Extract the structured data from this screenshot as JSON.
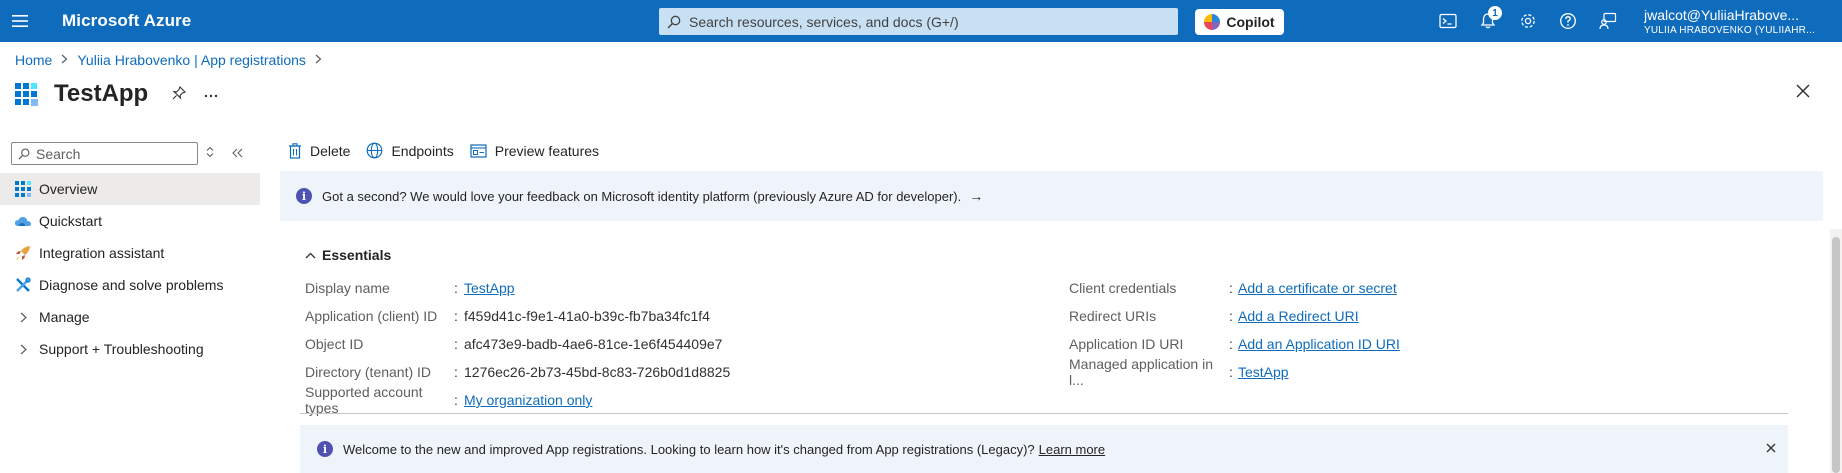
{
  "topbar": {
    "brand": "Microsoft Azure",
    "search_placeholder": "Search resources, services, and docs (G+/)",
    "copilot_label": "Copilot",
    "notification_count": "1",
    "account_email": "jwalcot@YuliiaHrabove...",
    "account_tenant": "YULIIA HRABOVENKO (YULIIAHR..."
  },
  "breadcrumb": {
    "home": "Home",
    "parent": "Yuliia Hrabovenko | App registrations"
  },
  "page": {
    "title": "TestApp"
  },
  "nav": {
    "search_placeholder": "Search",
    "items": [
      {
        "label": "Overview",
        "icon": "overview-icon"
      },
      {
        "label": "Quickstart",
        "icon": "quickstart-cloud-icon"
      },
      {
        "label": "Integration assistant",
        "icon": "rocket-icon"
      },
      {
        "label": "Diagnose and solve problems",
        "icon": "wrench-icon"
      },
      {
        "label": "Manage",
        "icon": "chevron-right-icon"
      },
      {
        "label": "Support + Troubleshooting",
        "icon": "chevron-right-icon"
      }
    ]
  },
  "commands": {
    "delete": "Delete",
    "endpoints": "Endpoints",
    "preview": "Preview features"
  },
  "feedback_banner": {
    "text": "Got a second? We would love your feedback on Microsoft identity platform (previously Azure AD for developer).",
    "arrow": "→"
  },
  "essentials": {
    "header": "Essentials",
    "left": [
      {
        "label": "Display name",
        "value": "TestApp",
        "link": true
      },
      {
        "label": "Application (client) ID",
        "value": "f459d41c-f9e1-41a0-b39c-fb7ba34fc1f4",
        "link": false
      },
      {
        "label": "Object ID",
        "value": "afc473e9-badb-4ae6-81ce-1e6f454409e7",
        "link": false
      },
      {
        "label": "Directory (tenant) ID",
        "value": "1276ec26-2b73-45bd-8c83-726b0d1d8825",
        "link": false
      },
      {
        "label": "Supported account types",
        "value": "My organization only",
        "link": true
      }
    ],
    "right": [
      {
        "label": "Client credentials",
        "value": "Add a certificate or secret",
        "link": true
      },
      {
        "label": "Redirect URIs",
        "value": "Add a Redirect URI",
        "link": true
      },
      {
        "label": "Application ID URI",
        "value": "Add an Application ID URI",
        "link": true
      },
      {
        "label": "Managed application in l...",
        "value": "TestApp",
        "link": true
      }
    ]
  },
  "welcome_banner": {
    "text": "Welcome to the new and improved App registrations. Looking to learn how it's changed from App registrations (Legacy)?",
    "link": "Learn more"
  },
  "colors": {
    "topbar": "#0f6cbd",
    "link": "#0f6cbd",
    "banner": "#eff4fb",
    "info": "#4f52b2"
  }
}
